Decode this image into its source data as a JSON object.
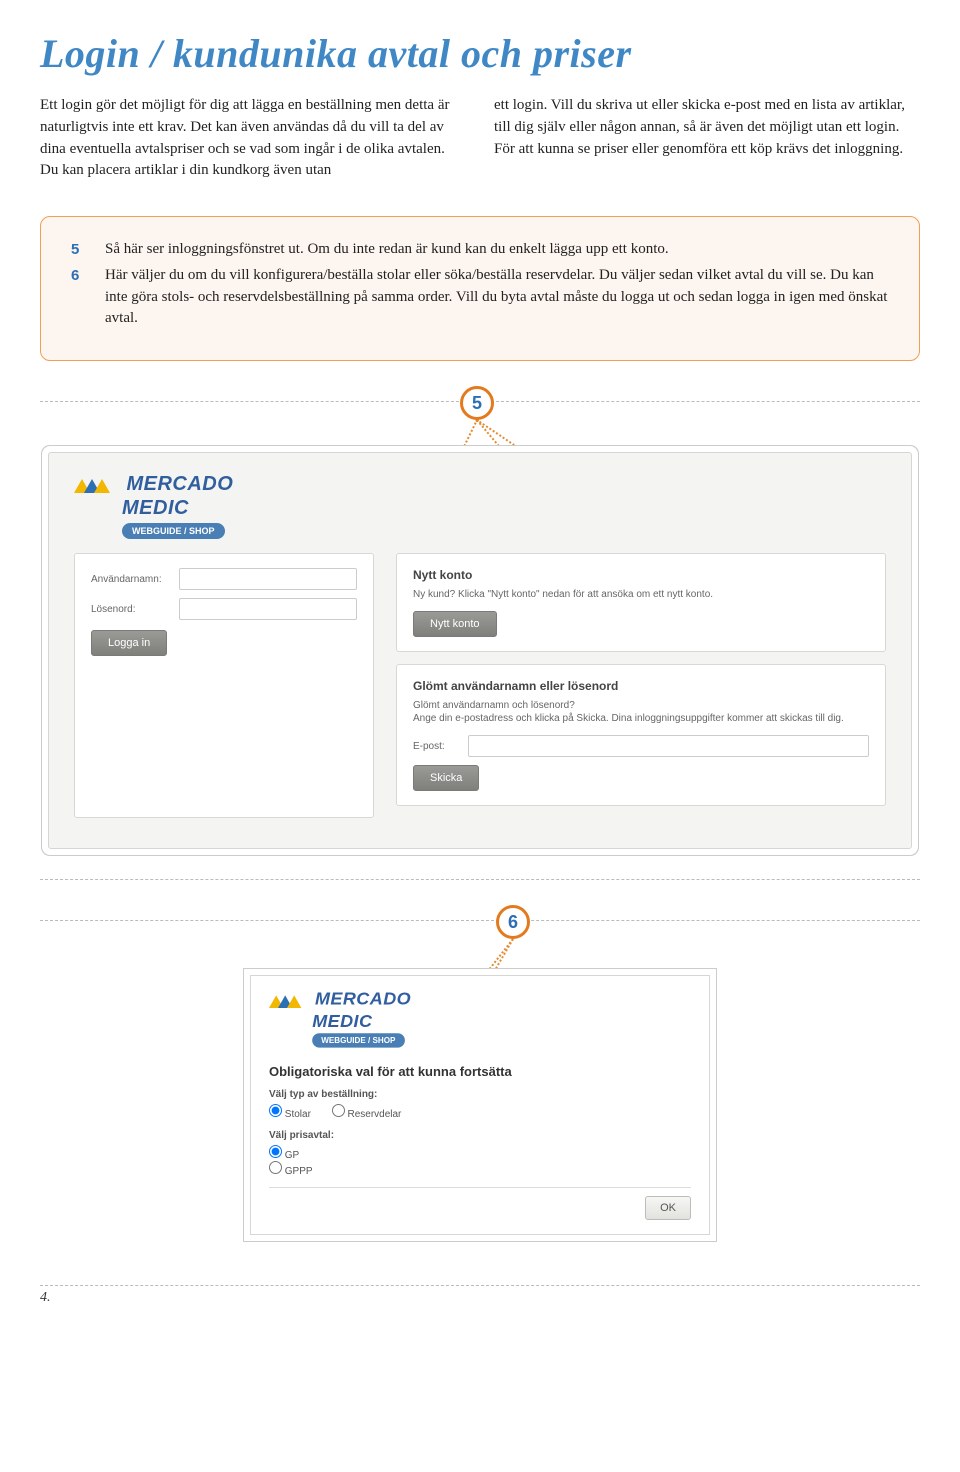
{
  "title": "Login / kundunika avtal och priser",
  "intro": {
    "col1": "Ett login gör det möjligt för dig att lägga en beställning men detta är naturligtvis inte ett krav. Det kan även användas då du vill ta del av dina eventuella avtalspriser och se vad som ingår i de olika avtalen. Du kan placera artiklar i din kundkorg även utan",
    "col2": "ett login. Vill du skriva ut eller skicka e-post med en lista av artiklar, till dig själv eller någon annan, så är även det möjligt utan ett login.\n    För att kunna se priser eller genomföra ett köp krävs det inloggning."
  },
  "info": {
    "n5": "5",
    "t5": "Så här ser inloggningsfönstret ut. Om du inte redan är kund kan du enkelt lägga upp ett konto.",
    "n6": "6",
    "t6": "Här väljer du om du vill konfigurera/beställa stolar eller söka/beställa reservdelar. Du väljer sedan vilket avtal du vill se. Du kan inte göra stols- och reservdelsbeställning på samma order. Vill du byta avtal måste du logga ut och sedan logga in igen med önskat avtal."
  },
  "marker5": "5",
  "marker6": "6",
  "logo": {
    "line1": "MERCADO",
    "line2": "MEDIC",
    "badge": "WEBGUIDE / SHOP"
  },
  "loginPanel": {
    "userLabel": "Användarnamn:",
    "passLabel": "Lösenord:",
    "loginBtn": "Logga in"
  },
  "newAcct": {
    "title": "Nytt konto",
    "sub": "Ny kund? Klicka \"Nytt konto\" nedan för att ansöka om ett nytt konto.",
    "btn": "Nytt konto"
  },
  "forgot": {
    "title": "Glömt användarnamn eller lösenord",
    "sub": "Glömt användarnamn och lösenord?\nAnge din e-postadress och klicka på Skicka. Dina inloggningsuppgifter kommer att skickas till dig.",
    "emailLabel": "E-post:",
    "btn": "Skicka"
  },
  "choice": {
    "title": "Obligatoriska val för att kunna fortsätta",
    "orderTypeLabel": "Välj typ av beställning:",
    "opt1": "Stolar",
    "opt2": "Reservdelar",
    "agreementLabel": "Välj prisavtal:",
    "ag1": "GP",
    "ag2": "GPPP",
    "okBtn": "OK"
  },
  "pageNum": "4."
}
